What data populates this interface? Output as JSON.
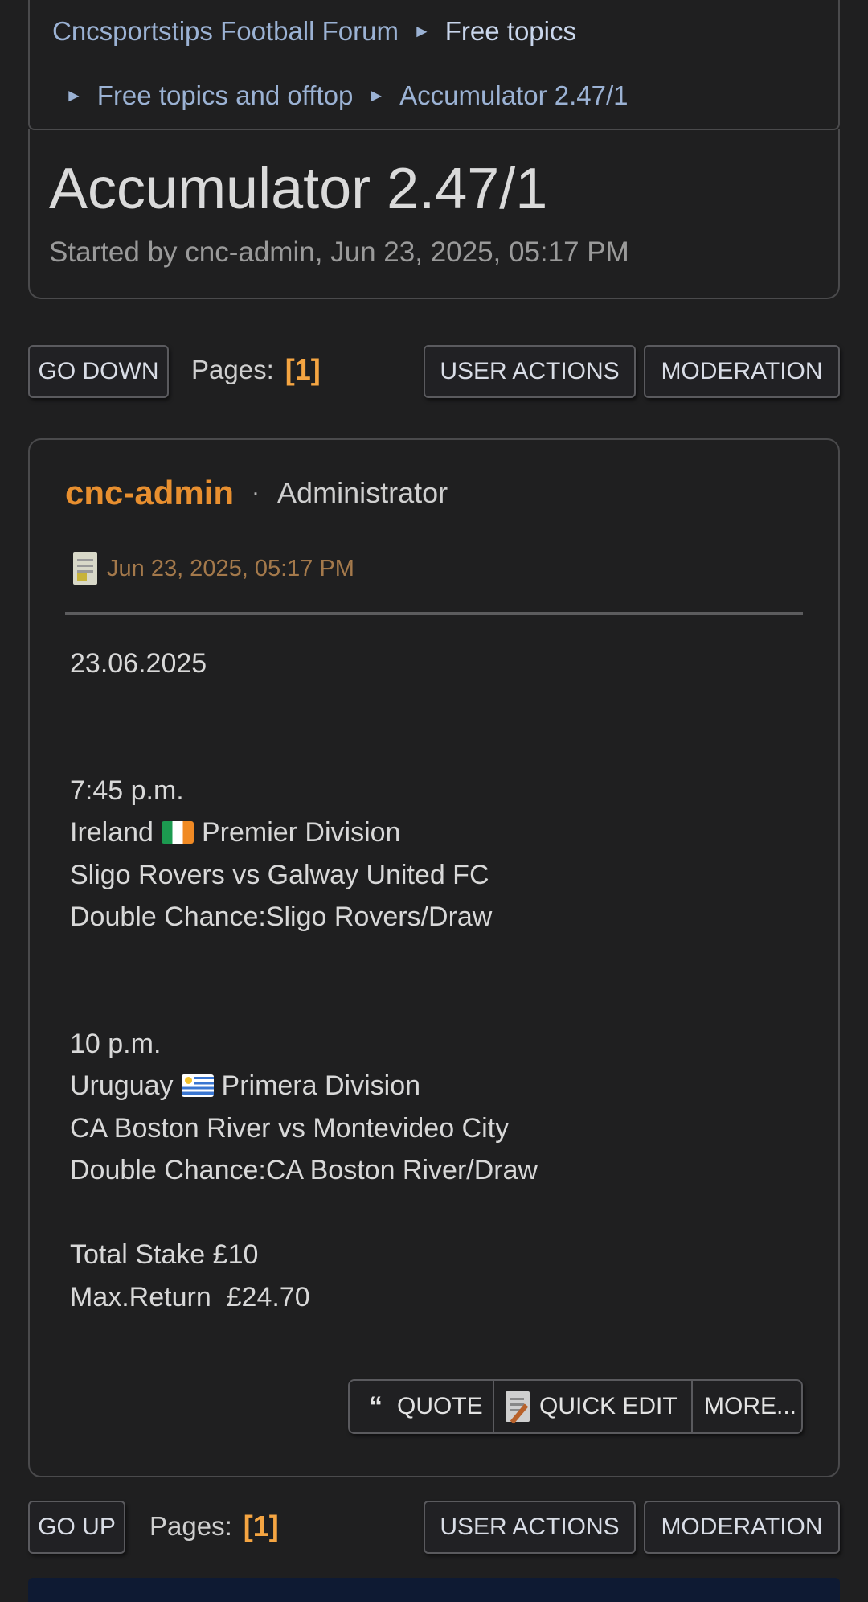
{
  "breadcrumb": {
    "forum": "Cncsportstips Football Forum",
    "board": "Free topics",
    "subboard": "Free topics and offtop",
    "topic": "Accumulator 2.47/1",
    "separator": "►"
  },
  "topic": {
    "title": "Accumulator 2.47/1",
    "started": "Started by cnc-admin, Jun 23, 2025, 05:17 PM"
  },
  "top_bar": {
    "go_label": "GO DOWN",
    "pages_label": "Pages:",
    "page_current": "[1]",
    "user_actions": "USER ACTIONS",
    "moderation": "MODERATION"
  },
  "post": {
    "author": "cnc-admin",
    "dot": "·",
    "role": "Administrator",
    "date": "Jun 23, 2025, 05:17 PM",
    "body": {
      "date": "23.06.2025",
      "match1": {
        "time": "7:45 p.m.",
        "league_country": "Ireland",
        "league_name": "Premier Division",
        "fixture": "Sligo Rovers vs Galway United FC",
        "bet": "Double Chance:Sligo Rovers/Draw"
      },
      "match2": {
        "time": "10 p.m.",
        "league_country": "Uruguay",
        "league_name": "Primera Division",
        "fixture": "CA Boston River vs Montevideo City",
        "bet": "Double Chance:CA Boston River/Draw"
      },
      "stake": "Total Stake £10",
      "max_return": "Max.Return  £24.70"
    },
    "actions": {
      "quote_icon": "“",
      "quote": "QUOTE",
      "quick_edit": "QUICK EDIT",
      "more": "MORE..."
    }
  },
  "bottom_bar": {
    "go_label": "GO UP",
    "pages_label": "Pages:",
    "page_current": "[1]",
    "user_actions": "USER ACTIONS",
    "moderation": "MODERATION"
  },
  "colors": {
    "background": "#1f1f20",
    "author": "#e88f2f",
    "page_number": "#f5a542",
    "link": "#9bb2d4"
  },
  "icons": {
    "post_date": "document-icon",
    "quick_edit": "edit-notepad-icon",
    "flag_ireland": "ireland-flag-icon",
    "flag_uruguay": "uruguay-flag-icon"
  }
}
